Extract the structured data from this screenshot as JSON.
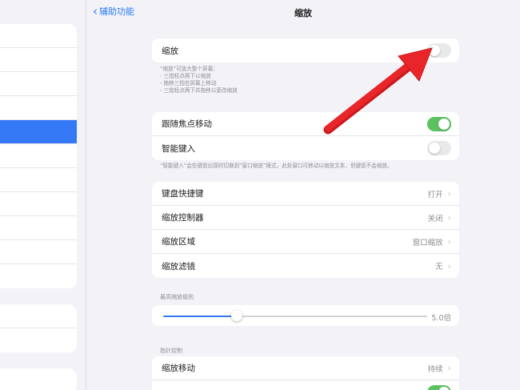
{
  "nav": {
    "back_label": "辅助功能",
    "title": "缩放"
  },
  "zoom_card": {
    "label": "缩放",
    "enabled": false
  },
  "zoom_note": {
    "intro": "“缩放”可放大整个屏幕：",
    "items": [
      "- 三指轻点两下以缩放",
      "- 拖移三指在屏幕上移动",
      "- 三指轻点两下并拖移以更改缩放"
    ]
  },
  "focus_card": {
    "follow_focus_label": "跟随焦点移动",
    "follow_focus_on": true,
    "smart_typing_label": "智能键入",
    "smart_typing_on": false
  },
  "smart_typing_note": "“智能键入”会在键盘出现时切换到“窗口缩放”模式，此处窗口可移动以缩放文本，但键盘不会缩放。",
  "options": [
    {
      "label": "键盘快捷键",
      "value": "打开"
    },
    {
      "label": "缩放控制器",
      "value": "关闭"
    },
    {
      "label": "缩放区域",
      "value": "窗口缩放"
    },
    {
      "label": "缩放滤镜",
      "value": "无"
    }
  ],
  "max_zoom": {
    "section_label": "最高缩放级别",
    "value_label": "5.0倍",
    "fraction": 0.28
  },
  "pointer": {
    "section_label": "指针控制",
    "move_label": "缩放移动",
    "move_value": "持续"
  },
  "colors": {
    "accent": "#3478f6",
    "toggle_on": "#5cc15f",
    "annotation_arrow": "#e8262a"
  }
}
